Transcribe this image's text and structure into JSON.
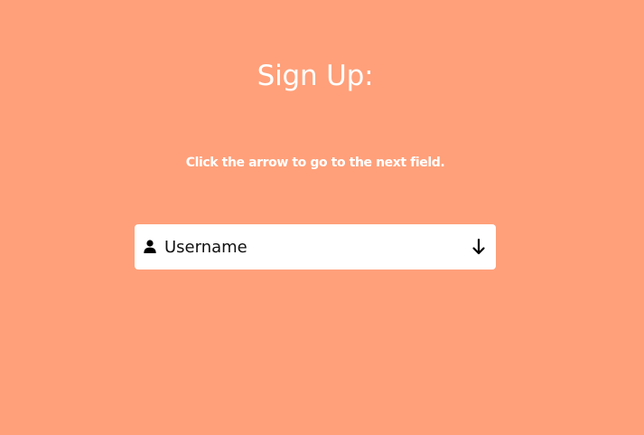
{
  "page": {
    "background_color": "#FFA07A"
  },
  "header": {
    "title": "Sign Up:"
  },
  "instructions": {
    "text": "Click the arrow to go to the next field."
  },
  "form": {
    "field": {
      "icon": "user-icon",
      "placeholder": "Username",
      "value": "",
      "next_icon": "arrow-down-icon"
    }
  }
}
